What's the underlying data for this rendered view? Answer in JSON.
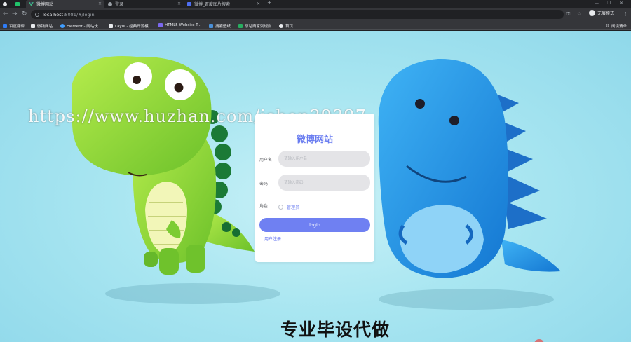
{
  "browser": {
    "tabs": [
      {
        "title": "",
        "icon": "chrome-app-icon"
      },
      {
        "title": "",
        "icon": "green-app-icon"
      },
      {
        "title": "微博网站",
        "icon": "vue-logo-icon",
        "active": true
      },
      {
        "title": "登录",
        "icon": "globe-icon"
      },
      {
        "title": "微博_百度图片搜索",
        "icon": "baidu-paw-icon"
      }
    ],
    "new_tab": "+",
    "url_host": "localhost",
    "url_rest": ":8081/#/login",
    "incognito_label": "无痕模式",
    "bookmarks": [
      {
        "label": "百度翻译",
        "icon": "translate-icon",
        "color": "#2f7cf6"
      },
      {
        "label": "微钱网站",
        "icon": "flag-icon",
        "color": "#e8eaed"
      },
      {
        "label": "Element - 网站快...",
        "icon": "element-icon",
        "color": "#409eff"
      },
      {
        "label": "Layui - 经典开源模...",
        "icon": "layui-icon",
        "color": "#e8eaed"
      },
      {
        "label": "HTML5 Website T...",
        "icon": "html5-icon",
        "color": "#7b68ee"
      },
      {
        "label": "搜索壁纸",
        "icon": "wallpaper-icon",
        "color": "#4a90d9"
      },
      {
        "label": "原站商家列规则",
        "icon": "shop-icon",
        "color": "#27ae60"
      },
      {
        "label": "首页",
        "icon": "github-icon",
        "color": "#e8eaed"
      }
    ],
    "reading_list": "阅读清单"
  },
  "page": {
    "watermark": "https://www.huzhan.com/ishop39397",
    "login": {
      "title": "微博网站",
      "username_label": "用户名",
      "username_placeholder": "请输入用户名",
      "password_label": "密码",
      "password_placeholder": "请输入密码",
      "role_label": "角色",
      "role_option": "管理员",
      "login_button": "login",
      "register_link": "用户注册"
    },
    "promo": "专业毕设代做"
  },
  "colors": {
    "accent": "#6f80f2",
    "title": "#6a7df0",
    "background": "#a9e6f1",
    "green_dino": "#8fd83a",
    "blue_dino": "#2a9de8"
  }
}
